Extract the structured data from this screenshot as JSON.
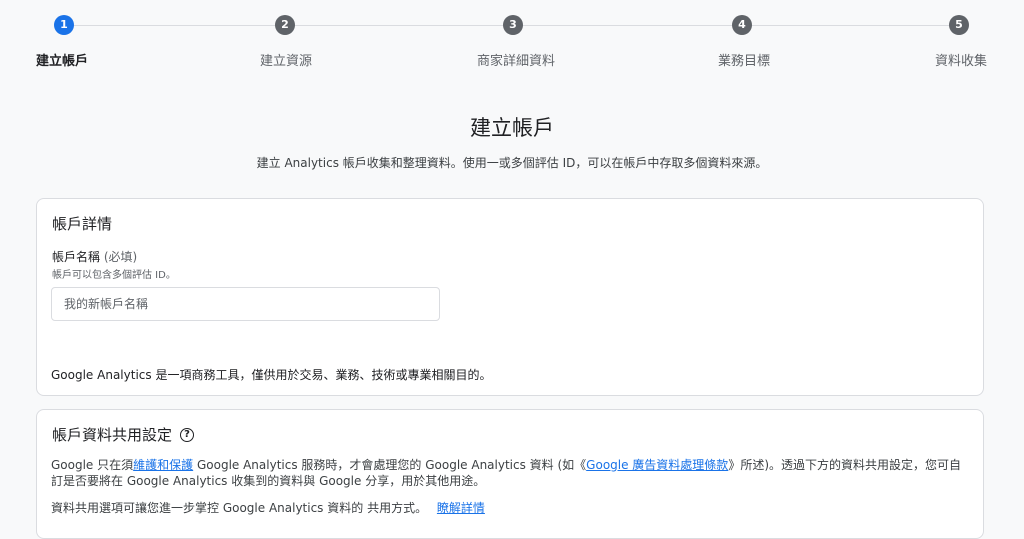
{
  "stepper": {
    "steps": [
      {
        "number": "1",
        "label": "建立帳戶",
        "active": true
      },
      {
        "number": "2",
        "label": "建立資源"
      },
      {
        "number": "3",
        "label": "商家詳細資料"
      },
      {
        "number": "4",
        "label": "業務目標"
      },
      {
        "number": "5",
        "label": "資料收集"
      }
    ]
  },
  "header": {
    "title": "建立帳戶",
    "subtitle": "建立 Analytics 帳戶收集和整理資料。使用一或多個評估 ID，可以在帳戶中存取多個資料來源。"
  },
  "account_details": {
    "title": "帳戶詳情",
    "field_label": "帳戶名稱",
    "field_required": "(必填)",
    "field_help": "帳戶可以包含多個評估 ID。",
    "input_placeholder": "我的新帳戶名稱",
    "input_value": "",
    "footnote": "Google Analytics 是一項商務工具，僅供用於交易、業務、技術或專業相關目的。"
  },
  "data_sharing": {
    "title": "帳戶資料共用設定",
    "para1_a": "Google 只在須",
    "para1_link1": "維護和保護",
    "para1_b": " Google Analytics 服務時，才會處理您的 Google Analytics 資料 (如《",
    "para1_link2": "Google 廣告資料處理條款",
    "para1_c": "》所述)。透過下方的資料共用設定，您可自訂是否要將在 Google Analytics 收集到的資料與 Google 分享，用於其他用途。",
    "para2": "資料共用選項可讓您進一步掌控 Google Analytics 資料的 共用方式。",
    "para2_link": "瞭解詳情"
  },
  "colors": {
    "accent": "#1a73e8",
    "inactive_step": "#5f6368",
    "background": "#f8f9fa"
  }
}
